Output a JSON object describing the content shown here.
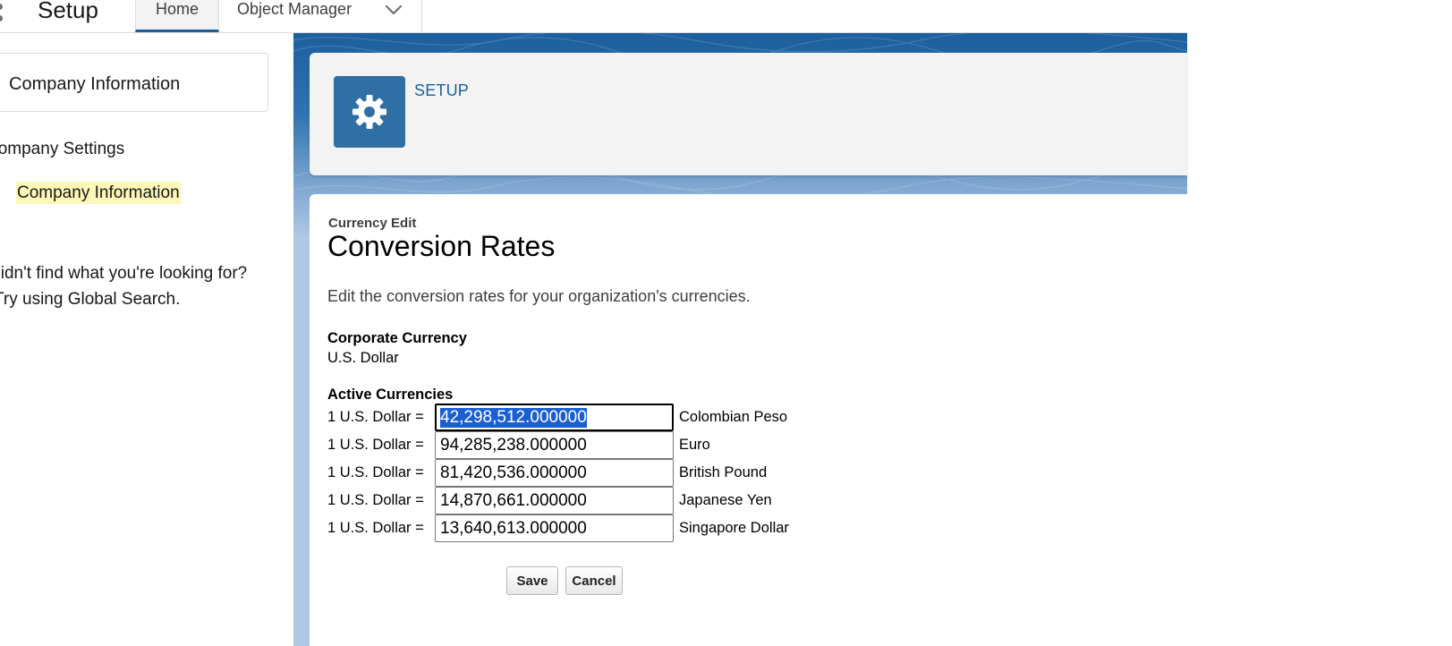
{
  "header": {
    "app_title": "Setup",
    "tabs": [
      {
        "label": "Home"
      },
      {
        "label": "Object Manager"
      }
    ]
  },
  "sidebar": {
    "quick_find_value": "Company Information",
    "group_label": "Company Settings",
    "selected_item": "Company Information",
    "help_line1": "Didn't find what you're looking for?",
    "help_line2": "Try using Global Search."
  },
  "setup_header": {
    "label": "SETUP",
    "icon": "gear-icon"
  },
  "page": {
    "breadcrumb": "Currency Edit",
    "title": "Conversion Rates",
    "description": "Edit the conversion rates for your organization's currencies.",
    "corporate_label": "Corporate Currency",
    "corporate_value": "U.S. Dollar",
    "active_label": "Active Currencies",
    "rates": [
      {
        "prefix": "1 U.S. Dollar =",
        "value": "42,298,512.000000",
        "currency": "Colombian Peso"
      },
      {
        "prefix": "1 U.S. Dollar =",
        "value": "94,285,238.000000",
        "currency": "Euro"
      },
      {
        "prefix": "1 U.S. Dollar =",
        "value": "81,420,536.000000",
        "currency": "British Pound"
      },
      {
        "prefix": "1 U.S. Dollar =",
        "value": "14,870,661.000000",
        "currency": "Japanese Yen"
      },
      {
        "prefix": "1 U.S. Dollar =",
        "value": "13,640,613.000000",
        "currency": "Singapore Dollar"
      }
    ],
    "save_label": "Save",
    "cancel_label": "Cancel"
  },
  "colors": {
    "brand_blue": "#1b5f9e",
    "icon_bg": "#2f6fa3",
    "highlight": "#fbf8b8",
    "selection": "#1a5fd1"
  }
}
